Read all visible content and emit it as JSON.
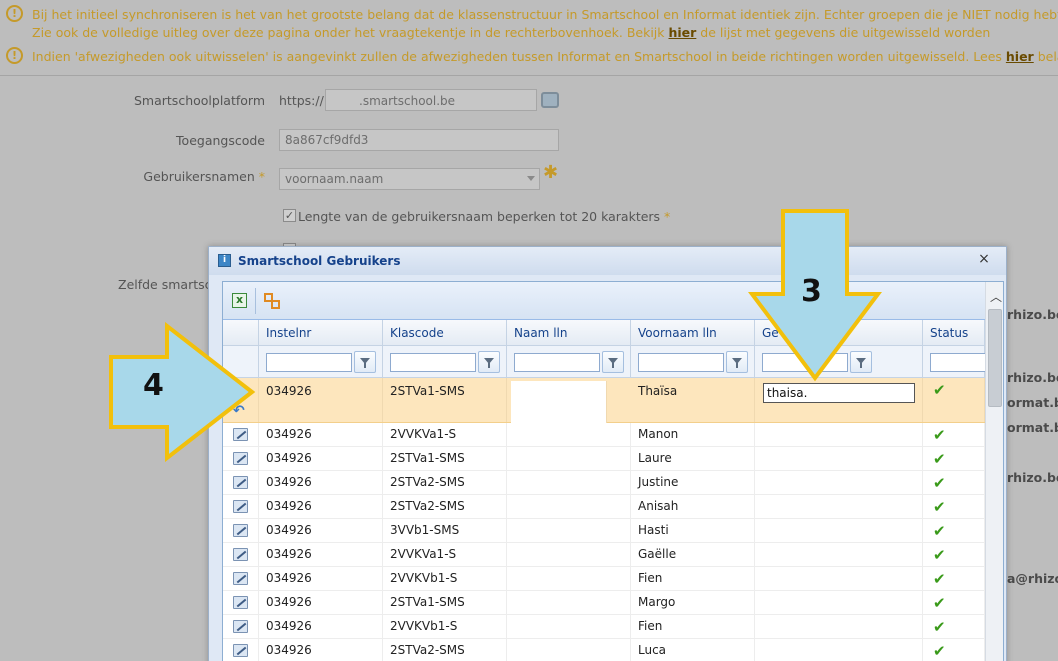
{
  "notices": [
    {
      "lines": [
        "Bij het initieel synchroniseren is het van het grootste belang dat de klassenstructuur in Smartschool en Informat identiek zijn. Echter groepen die je NIET nodig hebt in Informat",
        [
          "Zie ook de volledige uitleg over deze pagina onder het vraagtekentje in de rechterbovenhoek. Bekijk ",
          "hier",
          " de lijst met gegevens die uitgewisseld worden"
        ]
      ]
    },
    {
      "lines": [
        [
          "Indien 'afwezigheden ook uitwisselen' is aangevinkt zullen de afwezigheden tussen Informat en Smartschool in beide richtingen worden uitgewisseld. Lees ",
          "hier",
          " belangrijke info"
        ]
      ]
    }
  ],
  "form": {
    "platform_label": "Smartschoolplatform",
    "platform_prefix": "https://",
    "platform_suffix": ".smartschool.be",
    "code_label": "Toegangscode",
    "code_value": "8a867cf9dfd3",
    "usernames_label": "Gebruikersnamen",
    "usernames_required": "*",
    "usernames_value": "voornaam.naam",
    "limit_label": "Lengte van de gebruikersnaam beperken tot 20 karakters",
    "limit_required": "*",
    "zelfde_label": "Zelfde smartscho"
  },
  "right_fragments": [
    "rhizo.be",
    "rhizo.be",
    "ormat.be",
    "ormat.be",
    "rhizo.be",
    "a@rhizo.be"
  ],
  "dialog": {
    "title": "Smartschool Gebruikers",
    "close": "×",
    "columns": [
      "Instelnr",
      "Klascode",
      "Naam lln",
      "Voornaam lln",
      "Ge",
      "Status"
    ],
    "selected_row": {
      "instelnr": "034926",
      "klascode": "2STVa1-SMS",
      "naam": "",
      "voornaam": "Thaïsa",
      "editor_value": "thaisa."
    },
    "rows": [
      {
        "instelnr": "034926",
        "klascode": "2VVKVa1-S",
        "voornaam": "Manon"
      },
      {
        "instelnr": "034926",
        "klascode": "2STVa1-SMS",
        "voornaam": "Laure"
      },
      {
        "instelnr": "034926",
        "klascode": "2STVa2-SMS",
        "voornaam": "Justine"
      },
      {
        "instelnr": "034926",
        "klascode": "2STVa2-SMS",
        "voornaam": "Anisah"
      },
      {
        "instelnr": "034926",
        "klascode": "3VVb1-SMS",
        "voornaam": "Hasti"
      },
      {
        "instelnr": "034926",
        "klascode": "2VVKVa1-S",
        "voornaam": "Gaëlle"
      },
      {
        "instelnr": "034926",
        "klascode": "2VVKVb1-S",
        "voornaam": "Fien"
      },
      {
        "instelnr": "034926",
        "klascode": "2STVa1-SMS",
        "voornaam": "Margo"
      },
      {
        "instelnr": "034926",
        "klascode": "2VVKVb1-S",
        "voornaam": "Fien"
      },
      {
        "instelnr": "034926",
        "klascode": "2STVa2-SMS",
        "voornaam": "Luca"
      }
    ]
  },
  "annotations": {
    "arrow_down_label": "3",
    "arrow_right_label": "4"
  },
  "icons": {
    "status_ok": "check-icon",
    "edit": "pencil-icon",
    "undo": "undo-icon",
    "excel": "excel-export-icon",
    "columns": "column-config-icon",
    "filter": "filter-icon"
  },
  "colors": {
    "accent_warning": "#c59a2a",
    "selected_row": "#fde6bd",
    "arrow_fill": "#a8d8ea",
    "arrow_stroke": "#f2c00c"
  }
}
